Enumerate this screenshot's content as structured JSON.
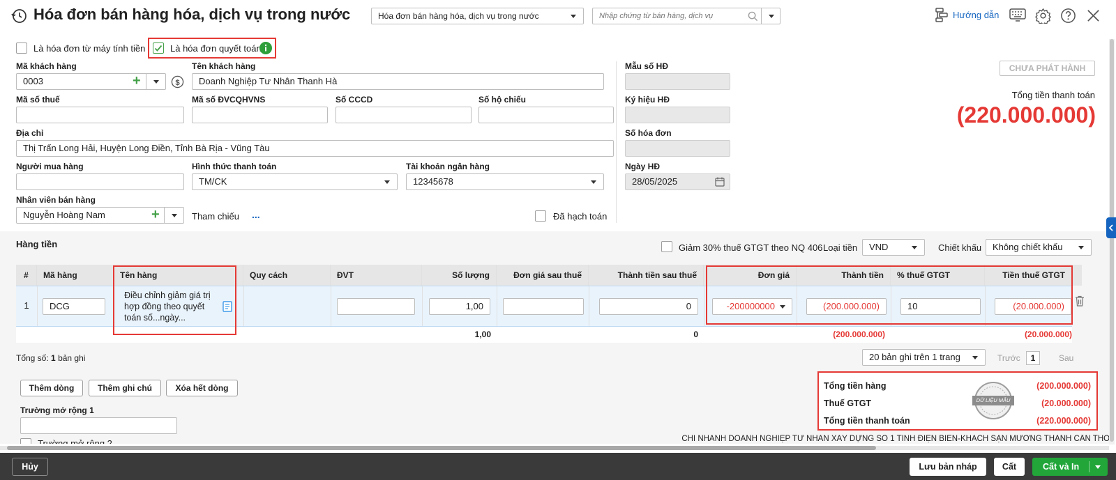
{
  "header": {
    "title": "Hóa đơn bán hàng hóa, dịch vụ trong nước",
    "type_select": "Hóa đơn bán hàng hóa, dịch vụ trong nước",
    "search_placeholder": "Nhập chứng từ bán hàng, dịch vụ",
    "guide_label": "Hướng dẫn"
  },
  "options": {
    "cash_register_label": "Là hóa đơn từ máy tính tiền",
    "settlement_label": "Là hóa đơn quyết toán"
  },
  "customer": {
    "code_label": "Mã khách hàng",
    "code": "0003",
    "name_label": "Tên khách hàng",
    "name": "Doanh Nghiệp Tư Nhân Thanh Hà",
    "tax_code_label": "Mã số thuế",
    "budget_code_label": "Mã số ĐVCQHVNS",
    "id_card_label": "Số CCCD",
    "passport_label": "Số hộ chiếu",
    "address_label": "Địa chỉ",
    "address": "Thị Trấn Long Hải, Huyện Long Điền, Tỉnh Bà Rịa - Vũng Tàu",
    "buyer_label": "Người mua hàng",
    "payment_method_label": "Hình thức thanh toán",
    "payment_method": "TM/CK",
    "bank_account_label": "Tài khoản ngân hàng",
    "bank_account": "12345678",
    "salesperson_label": "Nhân viên bán hàng",
    "salesperson": "Nguyễn Hoàng Nam",
    "reference_label": "Tham chiếu",
    "reference_more": "...",
    "posted_label": "Đã hạch toán"
  },
  "invoice": {
    "template_label": "Mẫu số HĐ",
    "symbol_label": "Ký hiệu HĐ",
    "number_label": "Số hóa đơn",
    "date_label": "Ngày HĐ",
    "date": "28/05/2025",
    "status": "CHƯA PHÁT HÀNH",
    "total_label": "Tổng tiền thanh toán",
    "total": "(220.000.000)"
  },
  "items_section": {
    "title": "Hàng tiền",
    "vat_reduction_label": "Giảm 30% thuế GTGT theo NQ 406",
    "currency_label": "Loại tiền",
    "currency": "VND",
    "discount_label": "Chiết khấu",
    "discount": "Không chiết khấu"
  },
  "table": {
    "headers": [
      "#",
      "Mã hàng",
      "Tên hàng",
      "Quy cách",
      "ĐVT",
      "Số lượng",
      "Đơn giá sau thuế",
      "Thành tiền sau thuế",
      "Đơn giá",
      "Thành tiền",
      "% thuế GTGT",
      "Tiền thuế GTGT"
    ],
    "rows": [
      {
        "no": "1",
        "code": "DCG",
        "name": "Điều chỉnh giảm giá trị hợp đồng theo quyết toán số...ngày...",
        "spec": "",
        "unit": "",
        "quantity": "1,00",
        "price_after_tax": "",
        "amount_after_tax": "0",
        "unit_price": "-200000000",
        "amount": "(200.000.000)",
        "vat_rate": "10",
        "vat_amount": "(20.000.000)"
      }
    ],
    "totals": {
      "quantity": "1,00",
      "amount_after_tax": "0",
      "amount": "(200.000.000)",
      "vat_amount": "(20.000.000)"
    }
  },
  "footer": {
    "record_count_prefix": "Tổng số:",
    "record_count": "1",
    "record_count_suffix": "bản ghi",
    "page_size": "20 bản ghi trên 1 trang",
    "prev_label": "Trước",
    "page": "1",
    "next_label": "Sau",
    "add_row": "Thêm dòng",
    "add_note": "Thêm ghi chú",
    "delete_all_rows": "Xóa hết dòng",
    "ext_field_1_label": "Trường mở rộng 1",
    "ext_field_2_label": "Trường mở rộng 2",
    "sum_goods_label": "Tổng tiền hàng",
    "sum_goods": "(200.000.000)",
    "sum_vat_label": "Thuế GTGT",
    "sum_vat": "(20.000.000)",
    "sum_total_label": "Tổng tiền thanh toán",
    "sum_total": "(220.000.000)",
    "watermark": "DỮ LIỆU MẪU",
    "company": "CHI NHÁNH DOANH NGHIỆP TƯ NHÂN XÂY DỰNG SỐ 1 TỈNH ĐIỆN BIÊN-KHÁCH SẠN MƯỜNG THANH CẦN THƠ"
  },
  "actions": {
    "cancel": "Hủy",
    "save_draft": "Lưu bản nháp",
    "save": "Cất",
    "save_print": "Cất và In"
  },
  "colors": {
    "accent_red": "#e53935",
    "brand_blue": "#1565c0",
    "primary_green": "#22a63a",
    "bottom_bar": "#3a3a3a"
  }
}
